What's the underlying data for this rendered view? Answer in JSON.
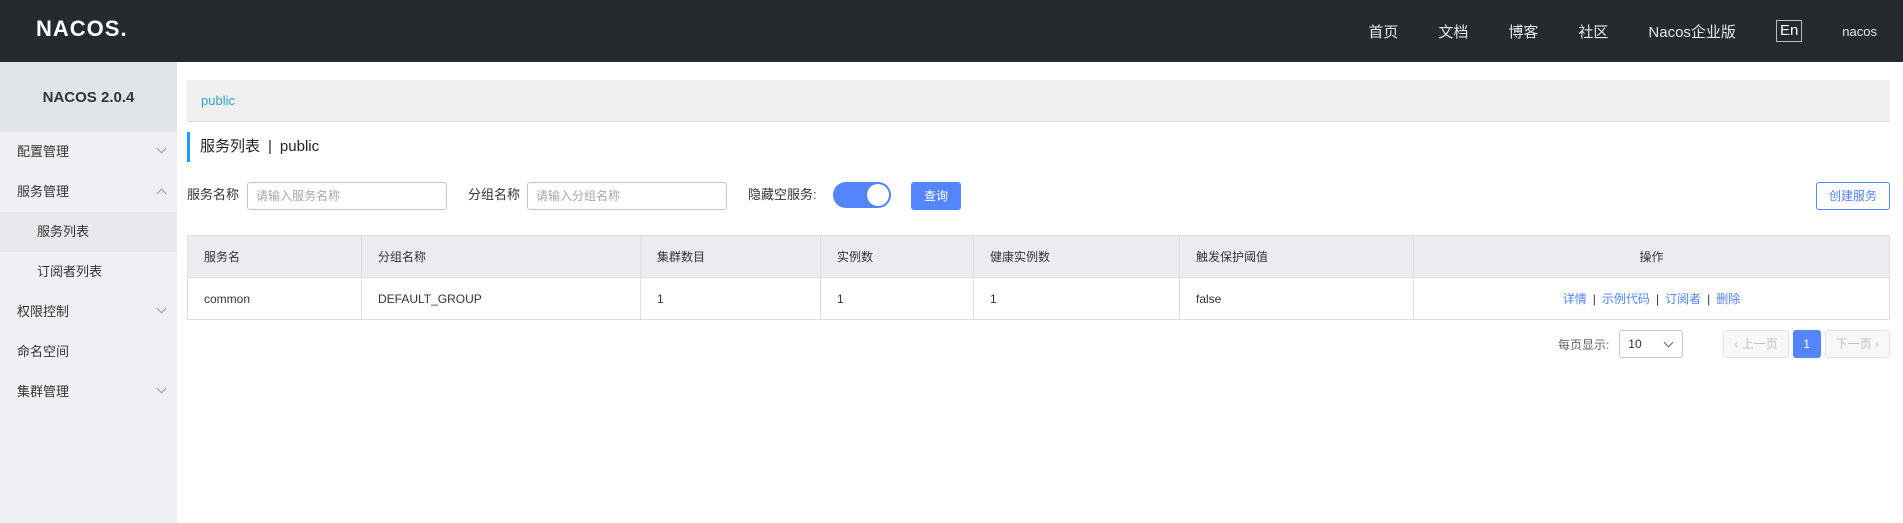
{
  "header": {
    "logo": "NACOS.",
    "nav": [
      "首页",
      "文档",
      "博客",
      "社区",
      "Nacos企业版"
    ],
    "lang_button": "En",
    "user": "nacos"
  },
  "sidebar": {
    "version": "NACOS 2.0.4",
    "items": [
      {
        "label": "配置管理",
        "chevron": "chevron-down-icon"
      },
      {
        "label": "服务管理",
        "chevron": "chevron-up-icon"
      },
      {
        "label": "服务列表"
      },
      {
        "label": "订阅者列表"
      },
      {
        "label": "权限控制",
        "chevron": "chevron-down-icon"
      },
      {
        "label": "命名空间"
      },
      {
        "label": "集群管理",
        "chevron": "chevron-down-icon"
      }
    ]
  },
  "namespace_bar": {
    "current": "public"
  },
  "page_title": {
    "title": "服务列表",
    "separator": "|",
    "namespace": "public"
  },
  "filters": {
    "service_name_label": "服务名称",
    "service_name_placeholder": "请输入服务名称",
    "group_name_label": "分组名称",
    "group_name_placeholder": "请输入分组名称",
    "hide_empty_label": "隐藏空服务:",
    "hide_empty_on": true,
    "query_button": "查询",
    "create_button": "创建服务"
  },
  "table": {
    "columns": [
      "服务名",
      "分组名称",
      "集群数目",
      "实例数",
      "健康实例数",
      "触发保护阈值",
      "操作"
    ],
    "rows": [
      {
        "cells": [
          "common",
          "DEFAULT_GROUP",
          "1",
          "1",
          "1",
          "false"
        ],
        "ops": [
          "详情",
          "示例代码",
          "订阅者",
          "删除"
        ]
      }
    ]
  },
  "pagination": {
    "per_page_label": "每页显示:",
    "per_page_value": "10",
    "prev": "上一页",
    "current_page": "1",
    "next": "下一页"
  },
  "colors": {
    "header_bg": "#252a2f",
    "sidebar_bg": "#eef0f3",
    "accent": "#5584ff"
  }
}
